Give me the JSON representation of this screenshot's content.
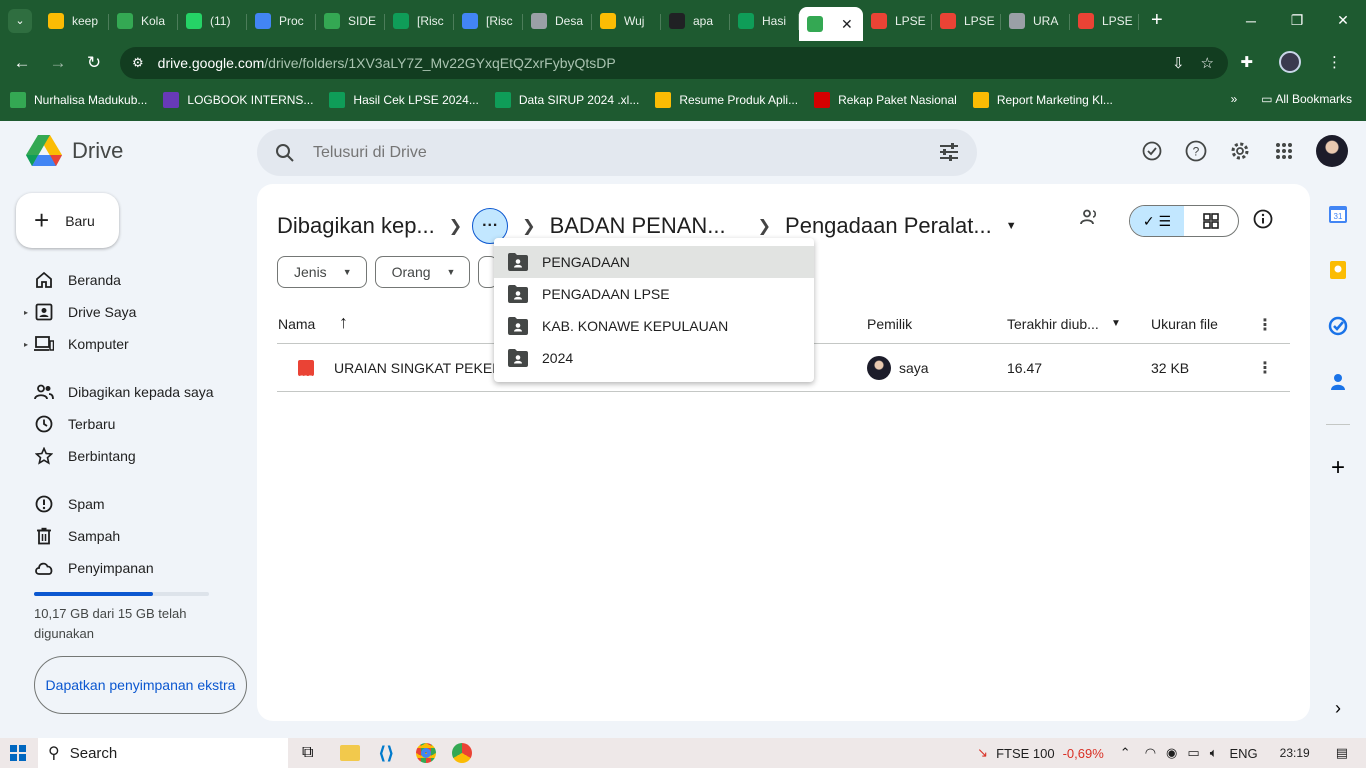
{
  "browser": {
    "tabs": [
      {
        "label": "keep",
        "color": "#fbbc04"
      },
      {
        "label": "Kola",
        "color": "#34a853"
      },
      {
        "label": "(11)",
        "color": "#25d366"
      },
      {
        "label": "Proc",
        "color": "#4285f4"
      },
      {
        "label": "SIDE",
        "color": "#34a853"
      },
      {
        "label": "[Risc",
        "color": "#0f9d58"
      },
      {
        "label": "[Risc",
        "color": "#4285f4"
      },
      {
        "label": "Desa",
        "color": "#9aa0a6"
      },
      {
        "label": "Wuj",
        "color": "#fbbc04"
      },
      {
        "label": "apa",
        "color": "#202124"
      },
      {
        "label": "Hasi",
        "color": "#0f9d58"
      }
    ],
    "active_tab": {
      "label": "",
      "color": "#34a853"
    },
    "tabs_after": [
      {
        "label": "LPSE",
        "color": "#ea4335"
      },
      {
        "label": "LPSE",
        "color": "#ea4335"
      },
      {
        "label": "URA",
        "color": "#9aa0a6"
      },
      {
        "label": "LPSE",
        "color": "#ea4335"
      }
    ],
    "url_domain": "drive.google.com",
    "url_path": "/drive/folders/1XV3aLY7Z_Mv22GYxqEtQZxrFybyQtsDP",
    "bookmarks": [
      {
        "label": "Nurhalisa Madukub...",
        "color": "#34a853"
      },
      {
        "label": "LOGBOOK INTERNS...",
        "color": "#673ab7"
      },
      {
        "label": "Hasil Cek LPSE 2024...",
        "color": "#0f9d58"
      },
      {
        "label": "Data SIRUP 2024 .xl...",
        "color": "#0f9d58"
      },
      {
        "label": "Resume Produk Apli...",
        "color": "#fbbc04"
      },
      {
        "label": "Rekap Paket Nasional",
        "color": "#d50000"
      },
      {
        "label": "Report Marketing Kl...",
        "color": "#fbbc04"
      }
    ],
    "all_bookmarks": "All Bookmarks"
  },
  "drive": {
    "logo_text": "Drive",
    "search_placeholder": "Telusuri di Drive",
    "new_label": "Baru",
    "nav": [
      {
        "label": "Beranda",
        "icon": "home-icon"
      },
      {
        "label": "Drive Saya",
        "icon": "my-drive-icon"
      },
      {
        "label": "Komputer",
        "icon": "computer-icon"
      },
      {
        "label": "Dibagikan kepada saya",
        "icon": "shared-icon"
      },
      {
        "label": "Terbaru",
        "icon": "clock-icon"
      },
      {
        "label": "Berbintang",
        "icon": "star-icon"
      },
      {
        "label": "Spam",
        "icon": "spam-icon"
      },
      {
        "label": "Sampah",
        "icon": "trash-icon"
      },
      {
        "label": "Penyimpanan",
        "icon": "cloud-icon"
      }
    ],
    "storage_used_fraction": 0.678,
    "storage_text": "10,17 GB dari 15 GB telah digunakan",
    "storage_button": "Dapatkan penyimpanan ekstra",
    "breadcrumb": {
      "first": "Dibagikan kep...",
      "second": "BADAN PENAN...",
      "current": "Pengadaan Peralat..."
    },
    "filters": [
      "Jenis",
      "Orang"
    ],
    "columns": {
      "name": "Nama",
      "owner": "Pemilik",
      "modified": "Terakhir diub...",
      "size": "Ukuran file"
    },
    "files": [
      {
        "name": "URAIAN SINGKAT PEKER",
        "owner": "saya",
        "modified": "16.47",
        "size": "32 KB",
        "type_badge": "PDF"
      }
    ],
    "breadcrumb_menu": [
      "PENGADAAN",
      "PENGADAAN LPSE",
      "KAB. KONAWE KEPULAUAN",
      "2024"
    ]
  },
  "taskbar": {
    "search": "Search",
    "ticker_name": "FTSE 100",
    "ticker_change": "-0,69%",
    "language": "ENG",
    "time": "23:19"
  }
}
